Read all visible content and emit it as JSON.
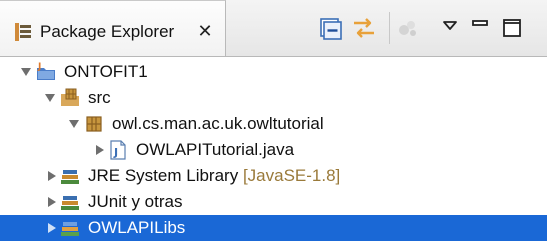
{
  "view": {
    "title": "Package Explorer",
    "close_label": "✕"
  },
  "toolbar": {
    "collapse_all_icon": "collapse-all-icon",
    "link_editor_icon": "link-with-editor-icon",
    "focus_icon": "focus-on-active-task-icon",
    "view_menu_icon": "view-menu-icon",
    "minimize_icon": "minimize-icon",
    "maximize_icon": "maximize-icon"
  },
  "tree": {
    "project": {
      "label": "ONTOFIT1"
    },
    "src": {
      "label": "src"
    },
    "package": {
      "label": "owl.cs.man.ac.uk.owltutorial"
    },
    "java_file": {
      "label": "OWLAPITutorial.java"
    },
    "jre": {
      "label": "JRE System Library",
      "decoration": "[JavaSE-1.8]"
    },
    "junit": {
      "label": "JUnit y otras"
    },
    "owlapilibs": {
      "label": "OWLAPILibs"
    }
  },
  "colors": {
    "selection": "#1a68d6",
    "decoration": "#9a7a3a",
    "accent_orange": "#e8a13a"
  }
}
